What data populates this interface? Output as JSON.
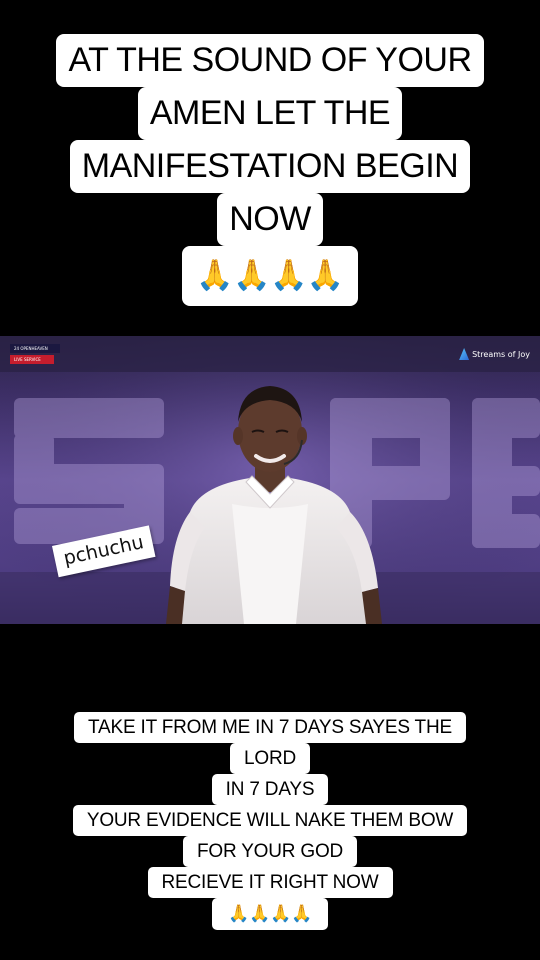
{
  "top_caption": {
    "lines": [
      "AT THE SOUND OF YOUR",
      "AMEN LET THE",
      "MANIFESTATION BEGIN",
      "NOW"
    ],
    "emoji": "🙏🙏🙏🙏"
  },
  "video": {
    "channel_name": "Streams of Joy",
    "broadcast_tag_1": "24 OPENHEAVEN",
    "broadcast_tag_2": "LIVE SERVICE",
    "backdrop_text": "SPE",
    "watermark": "pchuchu",
    "icons": {
      "channel_logo": "streams-of-joy-logo-icon"
    }
  },
  "bottom_caption": {
    "lines": [
      "TAKE IT FROM ME IN 7 DAYS SAYES THE",
      "LORD",
      "IN 7 DAYS",
      "YOUR EVIDENCE WILL NAKE THEM BOW",
      "FOR YOUR GOD",
      "RECIEVE IT RIGHT NOW"
    ],
    "emoji": "🙏🙏🙏🙏"
  },
  "colors": {
    "background": "#000000",
    "caption_bg": "#ffffff",
    "caption_text": "#000000",
    "stage_purple": "#5a4690"
  }
}
